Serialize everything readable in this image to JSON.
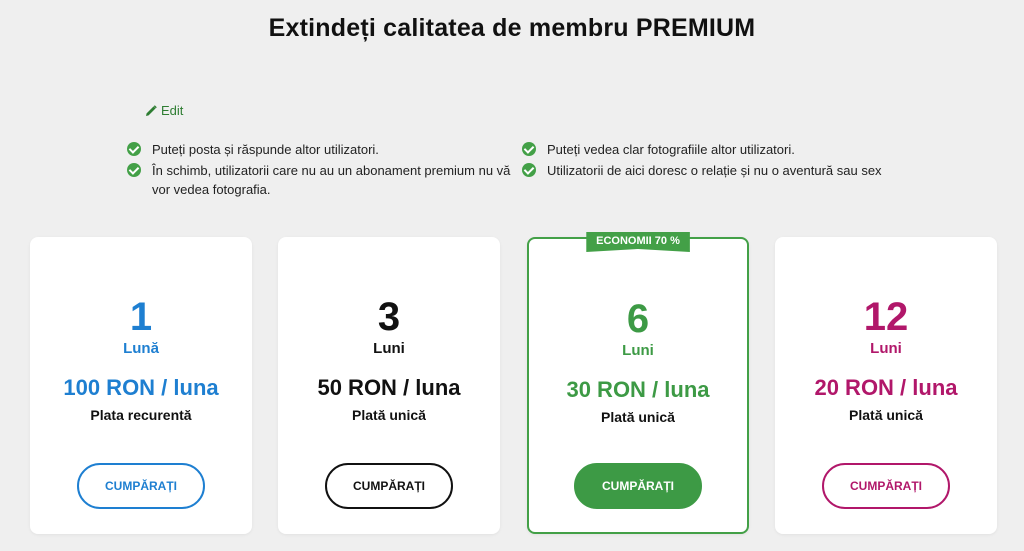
{
  "header": {
    "title": "Extindeți calitatea de membru PREMIUM"
  },
  "edit": {
    "label": "Edit",
    "icon": "pencil-icon"
  },
  "features": {
    "left": [
      "Puteți posta și răspunde altor utilizatori.",
      "În schimb, utilizatorii care nu au un abonament premium nu vă vor vedea fotografia."
    ],
    "right": [
      "Puteți vedea clar fotografiile altor utilizatori.",
      "Utilizatorii de aici doresc o relație și nu o aventură sau sex"
    ]
  },
  "plans": [
    {
      "number": "1",
      "unit": "Lună",
      "price": "100 RON / luna",
      "payment": "Plata recurentă",
      "button": "CUMPĂRAȚI",
      "color": "#1e7fd1"
    },
    {
      "number": "3",
      "unit": "Luni",
      "price": "50 RON / luna",
      "payment": "Plată unică",
      "button": "CUMPĂRAȚI",
      "color": "#111111"
    },
    {
      "number": "6",
      "unit": "Luni",
      "price": "30 RON / luna",
      "payment": "Plată unică",
      "button": "CUMPĂRAȚI",
      "color": "#3d9a45",
      "badge": "ECONOMII 70 %"
    },
    {
      "number": "12",
      "unit": "Luni",
      "price": "20 RON / luna",
      "payment": "Plată unică",
      "button": "CUMPĂRAȚI",
      "color": "#b1176a"
    }
  ]
}
